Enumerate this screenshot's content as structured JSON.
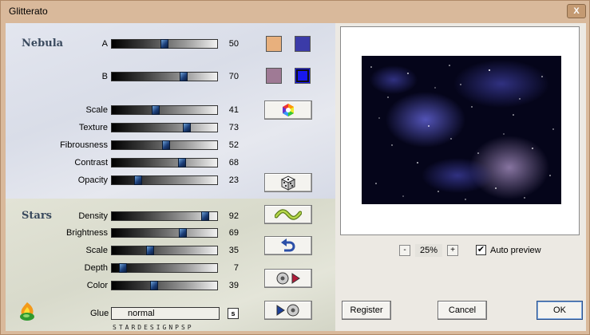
{
  "window": {
    "title": "Glitterato",
    "close_label": "X"
  },
  "nebula": {
    "title": "Nebula",
    "sliders": [
      {
        "key": "a",
        "label": "A",
        "value": "50",
        "level": 0.5
      },
      {
        "key": "b",
        "label": "B",
        "value": "70",
        "level": 0.7
      },
      {
        "key": "scale",
        "label": "Scale",
        "value": "41",
        "level": 0.41
      },
      {
        "key": "texture",
        "label": "Texture",
        "value": "73",
        "level": 0.73
      },
      {
        "key": "fibrousness",
        "label": "Fibrousness",
        "value": "52",
        "level": 0.52
      },
      {
        "key": "contrast",
        "label": "Contrast",
        "value": "68",
        "level": 0.68
      },
      {
        "key": "opacity",
        "label": "Opacity",
        "value": "23",
        "level": 0.23
      }
    ],
    "colors": {
      "a_left": "#e8b07d",
      "a_right": "#3b3ba8",
      "b_left": "#9f7a95",
      "b_right": "#1818ee"
    }
  },
  "stars": {
    "title": "Stars",
    "sliders": [
      {
        "key": "density",
        "label": "Density",
        "value": "92",
        "level": 0.92
      },
      {
        "key": "brightness",
        "label": "Brightness",
        "value": "69",
        "level": 0.69
      },
      {
        "key": "scale",
        "label": "Scale",
        "value": "35",
        "level": 0.35
      },
      {
        "key": "depth",
        "label": "Depth",
        "value": "7",
        "level": 0.07
      },
      {
        "key": "color",
        "label": "Color",
        "value": "39",
        "level": 0.39
      }
    ],
    "glue": {
      "label": "Glue",
      "value": "normal",
      "button": "s"
    }
  },
  "brand": {
    "text": "STARDESIGNPSP"
  },
  "preview": {
    "zoom": "25%",
    "minus": "-",
    "plus": "+",
    "auto_preview_label": "Auto preview",
    "auto_preview_checked": "✔"
  },
  "buttons": {
    "register": "Register",
    "cancel": "Cancel",
    "ok": "OK"
  },
  "icons": {
    "color_wheel": "color-wheel-icon",
    "dice": "dice-icon",
    "wave": "wave-icon",
    "undo": "undo-arrow-icon",
    "load": "load-preset-icon",
    "save": "save-preset-icon",
    "logo": "stardesign-logo-icon"
  }
}
